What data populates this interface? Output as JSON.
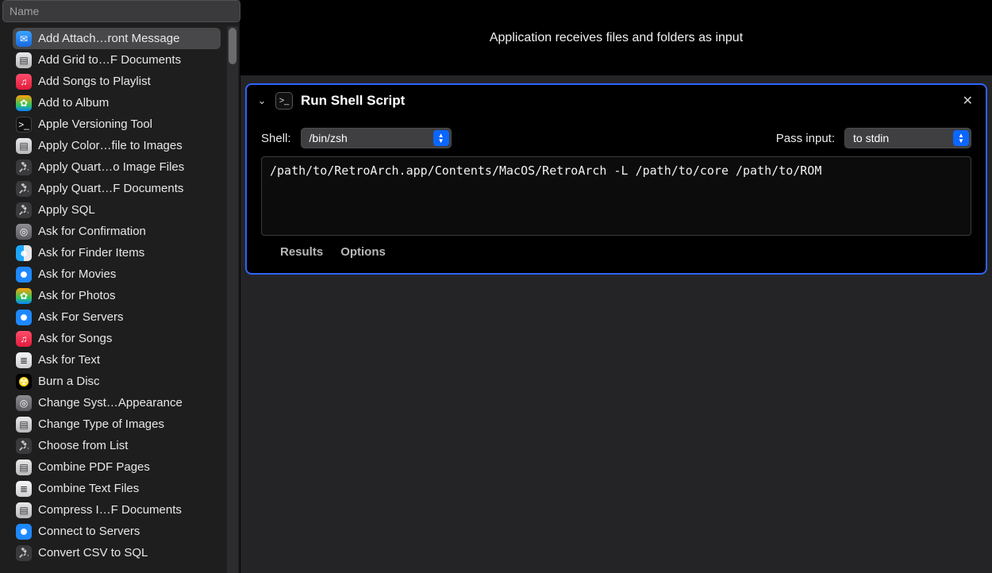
{
  "sidebar": {
    "search_placeholder": "Name",
    "items": [
      {
        "label": "Add Attach…ront Message",
        "icon": "mail",
        "selected": true
      },
      {
        "label": "Add Grid to…F Documents",
        "icon": "preview",
        "selected": false
      },
      {
        "label": "Add Songs to Playlist",
        "icon": "music",
        "selected": false
      },
      {
        "label": "Add to Album",
        "icon": "photos",
        "selected": false
      },
      {
        "label": "Apple Versioning Tool",
        "icon": "terminal",
        "selected": false
      },
      {
        "label": "Apply Color…file to Images",
        "icon": "preview",
        "selected": false
      },
      {
        "label": "Apply Quart…o Image Files",
        "icon": "tools",
        "selected": false
      },
      {
        "label": "Apply Quart…F Documents",
        "icon": "tools",
        "selected": false
      },
      {
        "label": "Apply SQL",
        "icon": "tools",
        "selected": false
      },
      {
        "label": "Ask for Confirmation",
        "icon": "sys",
        "selected": false
      },
      {
        "label": "Ask for Finder Items",
        "icon": "finder",
        "selected": false
      },
      {
        "label": "Ask for Movies",
        "icon": "safari",
        "selected": false
      },
      {
        "label": "Ask for Photos",
        "icon": "photos",
        "selected": false
      },
      {
        "label": "Ask For Servers",
        "icon": "safari",
        "selected": false
      },
      {
        "label": "Ask for Songs",
        "icon": "music",
        "selected": false
      },
      {
        "label": "Ask for Text",
        "icon": "text",
        "selected": false
      },
      {
        "label": "Burn a Disc",
        "icon": "burn",
        "selected": false
      },
      {
        "label": "Change Syst…Appearance",
        "icon": "sys",
        "selected": false
      },
      {
        "label": "Change Type of Images",
        "icon": "preview",
        "selected": false
      },
      {
        "label": "Choose from List",
        "icon": "tools",
        "selected": false
      },
      {
        "label": "Combine PDF Pages",
        "icon": "preview",
        "selected": false
      },
      {
        "label": "Combine Text Files",
        "icon": "text",
        "selected": false
      },
      {
        "label": "Compress I…F Documents",
        "icon": "preview",
        "selected": false
      },
      {
        "label": "Connect to Servers",
        "icon": "safari",
        "selected": false
      },
      {
        "label": "Convert CSV to SQL",
        "icon": "tools",
        "selected": false
      }
    ]
  },
  "banner": "Application receives files and folders as input",
  "action": {
    "title": "Run Shell Script",
    "shell_label": "Shell:",
    "shell_value": "/bin/zsh",
    "pass_input_label": "Pass input:",
    "pass_input_value": "to stdin",
    "script": "/path/to/RetroArch.app/Contents/MacOS/RetroArch -L /path/to/core /path/to/ROM",
    "footer": {
      "results": "Results",
      "options": "Options"
    }
  },
  "icons": {
    "mail": "✉",
    "preview": "▤",
    "music": "♫",
    "photos": "✿",
    "terminal": ">_",
    "tools": "✕",
    "finder": "☻",
    "safari": "✦",
    "text": "≣",
    "burn": "☢",
    "sys": "◎"
  }
}
